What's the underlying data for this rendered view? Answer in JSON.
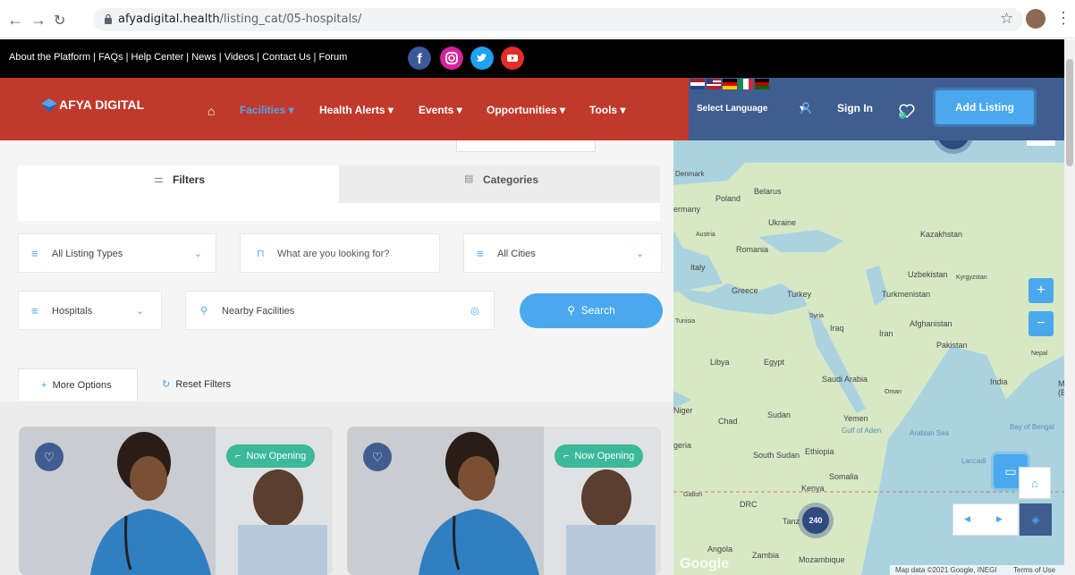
{
  "browser": {
    "url_domain": "afyadigital.health",
    "url_path": "/listing_cat/05-hospitals/"
  },
  "topbar": {
    "links": "About the Platform | FAQs | Help Center | News | Videos | Contact Us | Forum"
  },
  "header": {
    "logo": "AFYA DIGITAL",
    "menu": [
      "Facilities",
      "Health Alerts",
      "Events",
      "Opportunities",
      "Tools"
    ],
    "language": "Select Language",
    "sign_in": "Sign In",
    "add_listing": "Add Listing",
    "fav_count": "0"
  },
  "tabs": {
    "filters": "Filters",
    "categories": "Categories"
  },
  "search": {
    "listing_types": "All Listing Types",
    "what_placeholder": "What are you looking for?",
    "cities": "All Cities",
    "category": "Hospitals",
    "nearby_placeholder": "Nearby Facilities",
    "search_button": "Search",
    "more_options": "More Options",
    "reset_filters": "Reset Filters"
  },
  "cards": [
    {
      "badge": "Now Opening"
    },
    {
      "badge": "Now Opening"
    }
  ],
  "map": {
    "labels": {
      "denmark": "Denmark",
      "poland": "Poland",
      "belarus": "Belarus",
      "germany": "ermany",
      "ukraine": "Ukraine",
      "austria": "Austria",
      "romania": "Romania",
      "kazakhstan": "Kazakhstan",
      "italy": "Italy",
      "uzbekistan": "Uzbekistan",
      "kyrgyzstan": "Kyrgyzstan",
      "greece": "Greece",
      "turkey": "Turkey",
      "turkmenistan": "Turkmenistan",
      "tunisia": "Tunisia",
      "syria": "Syria",
      "afghanistan": "Afghanistan",
      "iraq": "Iraq",
      "iran": "Iran",
      "pakistan": "Pakistan",
      "nepal": "Nepal",
      "libya": "Libya",
      "egypt": "Egypt",
      "saudi": "Saudi Arabia",
      "india": "India",
      "oman": "Oman",
      "niger": "Niger",
      "chad": "Chad",
      "sudan": "Sudan",
      "yemen": "Yemen",
      "gulf_aden": "Gulf of Aden",
      "arabian_sea": "Arabian Sea",
      "bay_bengal": "Bay of Bengal",
      "nigeria": "geria",
      "south_sudan": "South Sudan",
      "ethiopia": "Ethiopia",
      "somalia": "Somalia",
      "laccadive": "Laccadi",
      "gabon": "Gabon",
      "kenya": "Kenya",
      "drc": "DRC",
      "tanzania": "Tanz",
      "angola": "Angola",
      "zambia": "Zambia",
      "mozambique": "Mozambique",
      "my": "My",
      "b": "(B"
    },
    "cluster_count": "240",
    "zoom_in": "+",
    "zoom_out": "−",
    "attribution": "Map data ©2021 Google, INEGI",
    "terms": "Terms of Use",
    "google": "Google",
    "colors": {
      "water": "#aad3df",
      "land": "#d7e8c5",
      "cluster": "#2f4a7e"
    }
  }
}
